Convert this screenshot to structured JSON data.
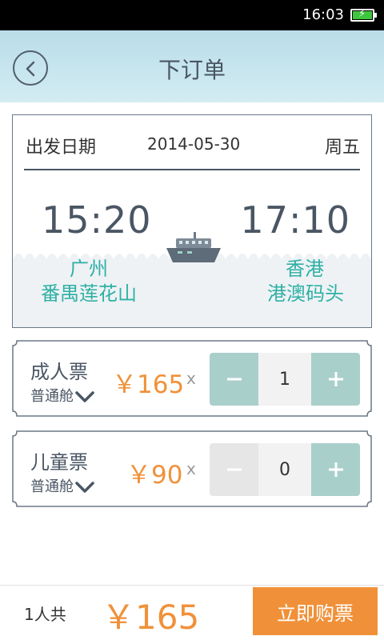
{
  "status_bar": {
    "time": "16:03",
    "icons": [
      "battery-charging-icon"
    ]
  },
  "header": {
    "title": "下订单",
    "back_icon": "back-arrow-icon"
  },
  "trip": {
    "date_label": "出发日期",
    "date": "2014-05-30",
    "weekday": "周五",
    "departure": {
      "time": "15:20",
      "city": "广州",
      "port": "番禺莲花山"
    },
    "arrival": {
      "time": "17:10",
      "city": "香港",
      "port": "港澳码头"
    },
    "vehicle_icon": "ferry-ship-icon"
  },
  "tickets": [
    {
      "type": "成人票",
      "cabin": "普通舱",
      "price": "￥165",
      "times": "x",
      "quantity": "1",
      "minus": "−",
      "plus": "+"
    },
    {
      "type": "儿童票",
      "cabin": "普通舱",
      "price": "￥90",
      "times": "x",
      "quantity": "0",
      "minus": "−",
      "plus": "+"
    }
  ],
  "footer": {
    "count": "1人共",
    "total": "￥165",
    "buy_label": "立即购票"
  },
  "colors": {
    "accent": "#f0913a",
    "teal": "#2fb0a4",
    "stepper": "#a9cfcb",
    "header_bg": "#c4e4ed"
  }
}
